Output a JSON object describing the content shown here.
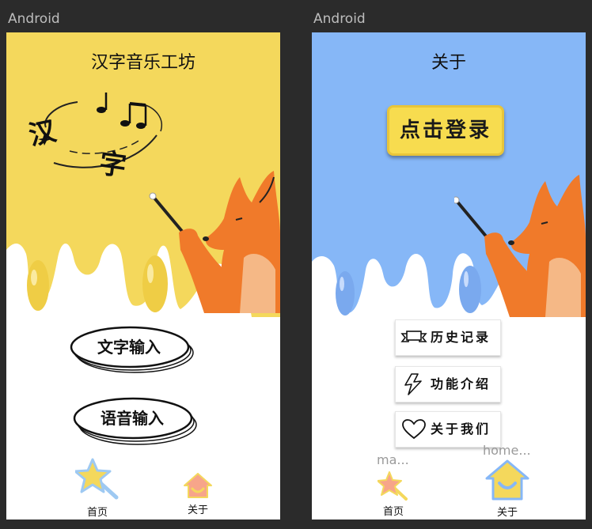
{
  "device_label": "Android",
  "colors": {
    "home_bg": "#f4d85c",
    "about_bg": "#86b7f7",
    "drip_yellow": "#f4d85c",
    "drip_blue": "#86b7f7",
    "login_btn": "#f7dc4f"
  },
  "home": {
    "title": "汉字音乐工坊",
    "logo_chars": [
      "汉",
      "字"
    ],
    "buttons": {
      "text_input": "文字输入",
      "voice_input": "语音输入"
    }
  },
  "about": {
    "title": "关于",
    "login_button": "点击登录",
    "menu": [
      {
        "label": "历史记录",
        "icon": "banner-icon"
      },
      {
        "label": "功能介绍",
        "icon": "lightning-icon"
      },
      {
        "label": "关于我们",
        "icon": "heart-icon"
      }
    ],
    "tooltips": {
      "home_tab": "ma...",
      "about_tab": "home..."
    }
  },
  "nav": {
    "home_label": "首页",
    "about_label": "关于"
  }
}
